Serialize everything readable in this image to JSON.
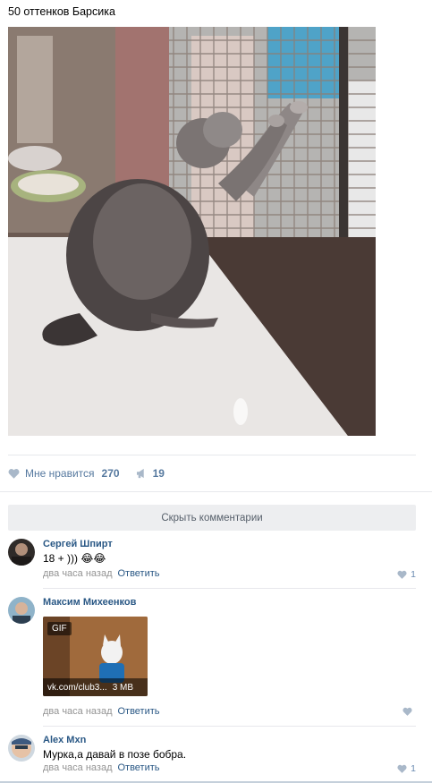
{
  "post": {
    "text": "50 оттенков Барсика",
    "image_alt": "Кот на подоконнике"
  },
  "actions": {
    "like_label": "Мне нравится",
    "like_count": "270",
    "share_count": "19"
  },
  "comments_toggle": "Скрыть комментарии",
  "reply_label": "Ответить",
  "comments": [
    {
      "author": "Сергей Шпирт",
      "text": "18 + ))) 😂😂",
      "time": "два часа назад",
      "likes": "1"
    },
    {
      "author": "Максим Михеенков",
      "gif_badge": "GIF",
      "gif_source": "vk.com/club3...",
      "gif_size": "3 MB",
      "time": "два часа назад",
      "likes": ""
    },
    {
      "author": "Alex Mxn",
      "text": "Мурка,а давай в позе бобра.",
      "time": "два часа назад",
      "likes": "1"
    }
  ],
  "colors": {
    "link": "#2a5885",
    "accent": "#56799f",
    "meta": "#939393",
    "button_bg": "#edeef0",
    "divider": "#e7e8ec"
  },
  "icons": [
    "heart-icon",
    "megaphone-icon"
  ]
}
